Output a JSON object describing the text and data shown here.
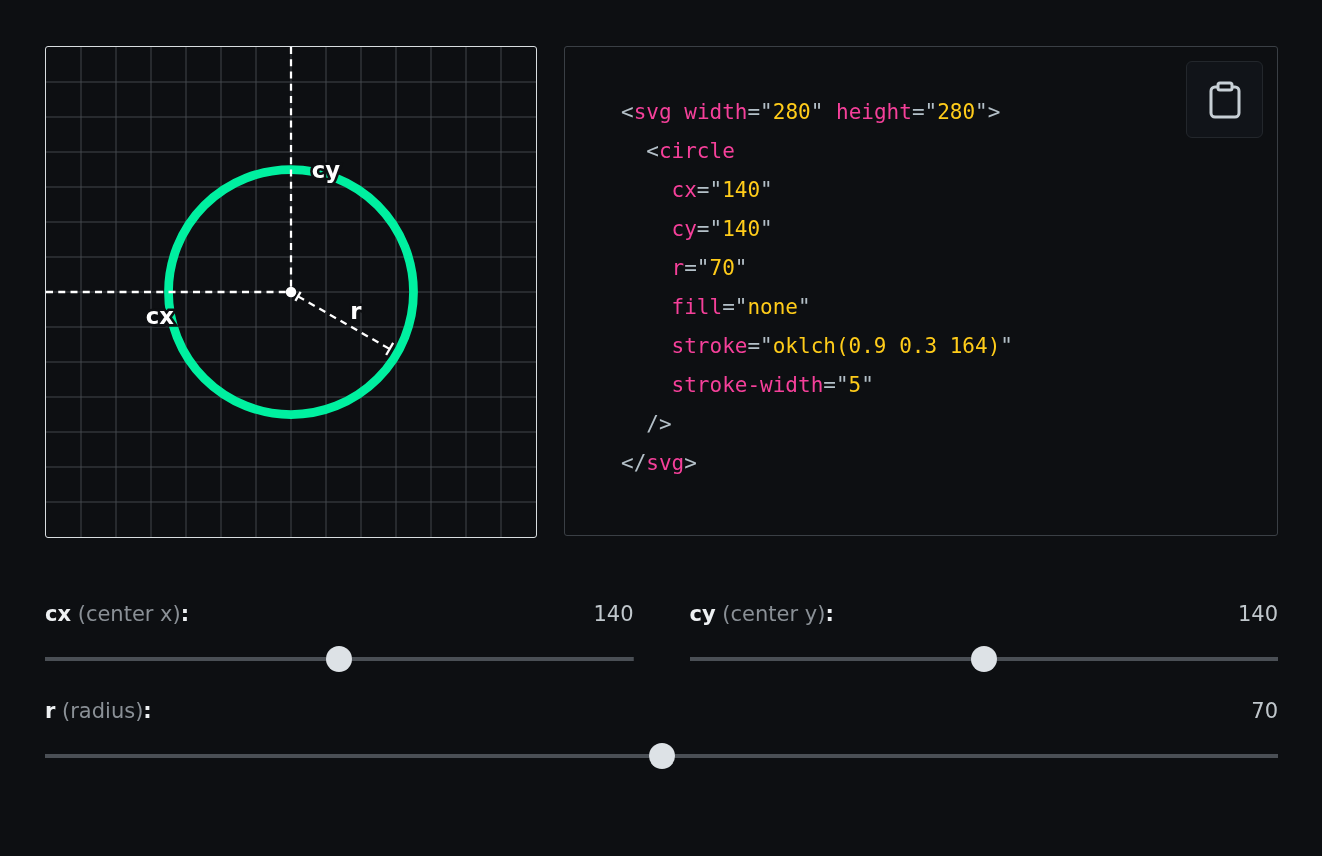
{
  "canvas": {
    "labels": [
      {
        "kind": "cx",
        "text": "cx"
      },
      {
        "kind": "cy",
        "text": "cy"
      },
      {
        "kind": "r",
        "text": "r"
      }
    ]
  },
  "code": {
    "lines": [
      {
        "kind": "root",
        "tokens": [
          {
            "kind": "punct",
            "text": "<"
          },
          {
            "kind": "tag",
            "text": "svg"
          },
          {
            "kind": "attr",
            "text": "width"
          },
          {
            "kind": "punct",
            "text": "=\""
          },
          {
            "kind": "value",
            "text": "280"
          },
          {
            "kind": "punct",
            "text": "\""
          },
          {
            "kind": "attr",
            "text": "height"
          },
          {
            "kind": "punct",
            "text": "=\""
          },
          {
            "kind": "value",
            "text": "280"
          },
          {
            "kind": "punct",
            "text": "\">"
          }
        ]
      },
      {
        "kind": "child",
        "tokens": [
          {
            "kind": "punct",
            "text": "<"
          },
          {
            "kind": "tag",
            "text": "circle"
          }
        ]
      },
      {
        "kind": "prop",
        "tokens": [
          {
            "kind": "attr",
            "text": "cx"
          },
          {
            "kind": "punct",
            "text": "=\""
          },
          {
            "kind": "value",
            "text": "140"
          },
          {
            "kind": "punct",
            "text": "\""
          }
        ]
      },
      {
        "kind": "prop",
        "tokens": [
          {
            "kind": "attr",
            "text": "cy"
          },
          {
            "kind": "punct",
            "text": "=\""
          },
          {
            "kind": "value",
            "text": "140"
          },
          {
            "kind": "punct",
            "text": "\""
          }
        ]
      },
      {
        "kind": "prop",
        "tokens": [
          {
            "kind": "attr",
            "text": "r"
          },
          {
            "kind": "punct",
            "text": "=\""
          },
          {
            "kind": "value",
            "text": "70"
          },
          {
            "kind": "punct",
            "text": "\""
          }
        ]
      },
      {
        "kind": "prop",
        "tokens": [
          {
            "kind": "attr",
            "text": "fill"
          },
          {
            "kind": "punct",
            "text": "=\""
          },
          {
            "kind": "value",
            "text": "none"
          },
          {
            "kind": "punct",
            "text": "\""
          }
        ]
      },
      {
        "kind": "prop",
        "tokens": [
          {
            "kind": "attr",
            "text": "stroke"
          },
          {
            "kind": "punct",
            "text": "=\""
          },
          {
            "kind": "value",
            "text": "oklch(0.9 0.3 164)"
          },
          {
            "kind": "punct",
            "text": "\""
          }
        ]
      },
      {
        "kind": "prop",
        "tokens": [
          {
            "kind": "attr",
            "text": "stroke-width"
          },
          {
            "kind": "punct",
            "text": "=\""
          },
          {
            "kind": "value",
            "text": "5"
          },
          {
            "kind": "punct",
            "text": "\""
          }
        ]
      },
      {
        "kind": "child",
        "tokens": [
          {
            "kind": "punct",
            "text": "/>"
          }
        ]
      },
      {
        "kind": "root",
        "tokens": [
          {
            "kind": "punct",
            "text": "</"
          },
          {
            "kind": "tag",
            "text": "svg"
          },
          {
            "kind": "punct",
            "text": ">"
          }
        ]
      }
    ]
  },
  "sliders": [
    {
      "kind": "cx",
      "name": "cx",
      "hint": "(center x)",
      "suffix": ":",
      "value": "140",
      "level": 0.5
    },
    {
      "kind": "cy",
      "name": "cy",
      "hint": "(center y)",
      "suffix": ":",
      "value": "140",
      "level": 0.5
    },
    {
      "kind": "r",
      "name": "r",
      "hint": "(radius)",
      "suffix": ":",
      "value": "70",
      "level": 0.5
    }
  ]
}
